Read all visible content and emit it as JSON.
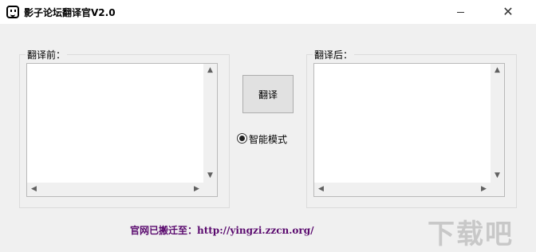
{
  "window": {
    "title": "影子论坛翻译官V2.0",
    "minimize_icon": "minimize-icon",
    "close_icon": "close-icon",
    "close_glyph": "✕"
  },
  "source_panel": {
    "label": "翻译前：",
    "text": ""
  },
  "target_panel": {
    "label": "翻译后：",
    "text": ""
  },
  "translate_button": {
    "label": "翻译"
  },
  "mode_option": {
    "label": "智能模式",
    "checked": true
  },
  "footer": {
    "text": "官网已搬迁至：http://yingzi.zzcn.org/"
  },
  "watermark": {
    "text": "下载吧"
  },
  "scroll_arrows": {
    "up": "▲",
    "down": "▼",
    "left": "◀",
    "right": "▶"
  }
}
